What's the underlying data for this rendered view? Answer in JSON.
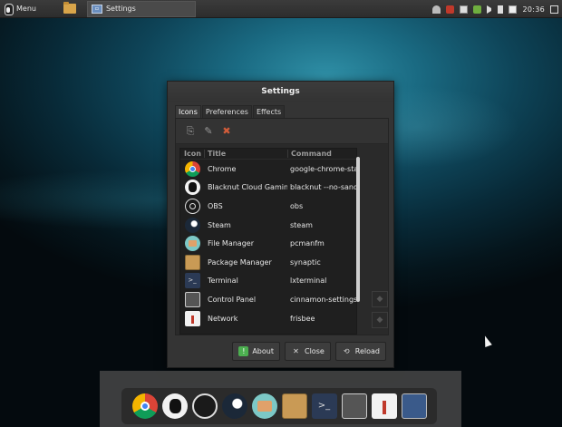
{
  "top_panel": {
    "menu_label": "Menu",
    "task_label": "Settings",
    "clock": "20:36"
  },
  "dialog": {
    "title": "Settings",
    "tabs": [
      {
        "label": "Icons"
      },
      {
        "label": "Preferences"
      },
      {
        "label": "Effects"
      }
    ],
    "columns": {
      "icon": "Icon",
      "title": "Title",
      "command": "Command"
    },
    "rows": [
      {
        "title": "Chrome",
        "command": "google-chrome-sta",
        "icon": "chrome-icon"
      },
      {
        "title": "Blacknut Cloud Gaming",
        "command": "blacknut --no-sand",
        "icon": "blacknut-icon"
      },
      {
        "title": "OBS",
        "command": "obs",
        "icon": "obs-icon"
      },
      {
        "title": "Steam",
        "command": "steam",
        "icon": "steam-icon"
      },
      {
        "title": "File Manager",
        "command": "pcmanfm",
        "icon": "file-manager-icon"
      },
      {
        "title": "Package Manager",
        "command": "synaptic",
        "icon": "package-manager-icon"
      },
      {
        "title": "Terminal",
        "command": "lxterminal",
        "icon": "terminal-icon"
      },
      {
        "title": "Control Panel",
        "command": "cinnamon-settings",
        "icon": "control-panel-icon"
      },
      {
        "title": "Network",
        "command": "frisbee",
        "icon": "network-icon"
      }
    ],
    "buttons": {
      "about": "About",
      "close": "Close",
      "reload": "Reload"
    }
  },
  "dock_icons": [
    "chrome-icon",
    "blacknut-icon",
    "obs-icon",
    "steam-icon",
    "file-manager-icon",
    "package-manager-icon",
    "terminal-icon",
    "control-panel-icon",
    "network-icon",
    "extra-app-icon"
  ]
}
